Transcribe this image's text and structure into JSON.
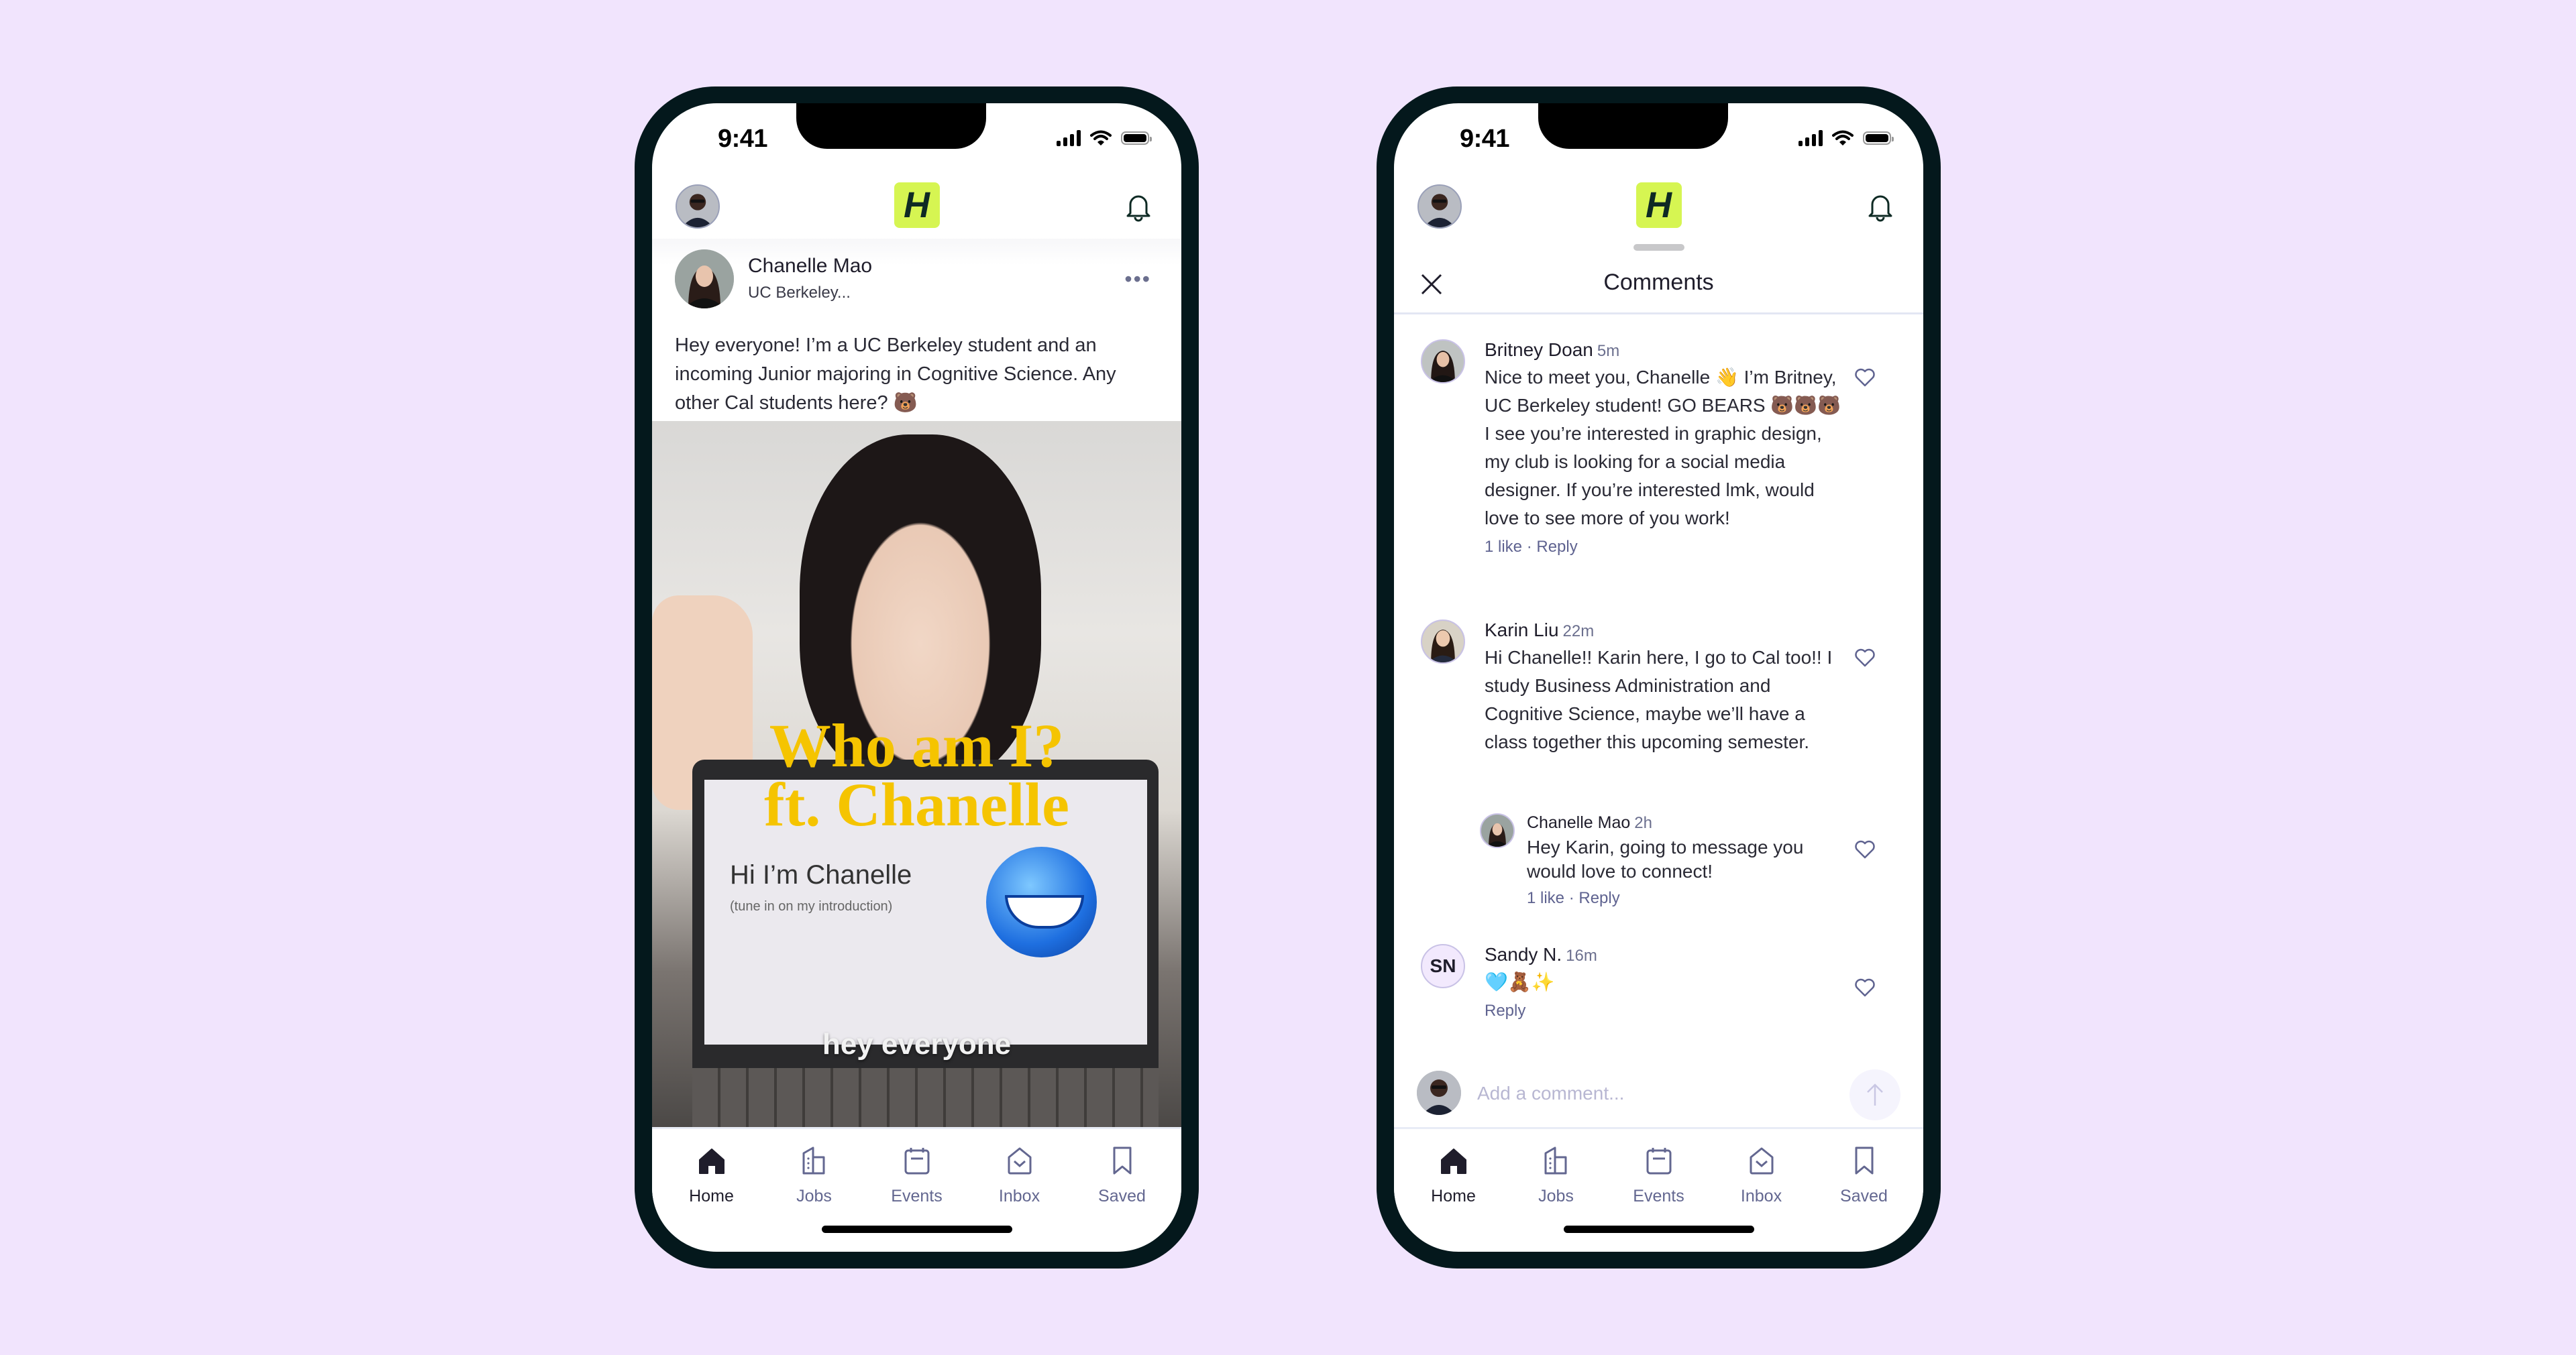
{
  "status_bar": {
    "time": "9:41"
  },
  "app": {
    "logo_letter": "H",
    "brand_color": "#d6f552",
    "background_color": "#f1e4fd"
  },
  "feed": {
    "post": {
      "author": "Chanelle Mao",
      "subtitle": "UC Berkeley...",
      "more_label": "•••",
      "text": "Hey everyone! I’m a UC Berkeley student and an incoming Junior majoring in Cognitive Science. Any other Cal students here? 🐻",
      "video": {
        "title_line1": "Who am I?",
        "title_line2": "ft. Chanelle",
        "slide_heading": "Hi I’m Chanelle",
        "slide_subtext": "(tune in on my introduction)",
        "caption": "hey everyone"
      }
    }
  },
  "comments_sheet": {
    "title": "Comments",
    "comments": [
      {
        "author": "Britney Doan",
        "time": "5m",
        "text": "Nice to meet you, Chanelle 👋 I’m Britney, UC Berkeley student! GO BEARS 🐻🐻🐻 I see you’re interested in graphic design, my club is looking for a social media designer. If you’re interested lmk, would love to see more of you work!",
        "likes": "1 like",
        "reply": "Reply"
      },
      {
        "author": "Karin Liu",
        "time": "22m",
        "text": "Hi Chanelle!! Karin here, I go to Cal too!! I study Business Administration and Cognitive Science, maybe we’ll have a class together this upcoming semester."
      },
      {
        "author": "Chanelle Mao",
        "time": "2h",
        "text": "Hey Karin, going to message you would love to connect!",
        "likes": "1 like",
        "reply": "Reply"
      },
      {
        "author": "Sandy N.",
        "initials": "SN",
        "time": "16m",
        "text": "🩵🧸✨",
        "reply": "Reply"
      }
    ],
    "input_placeholder": "Add a comment..."
  },
  "tabs": [
    {
      "label": "Home",
      "icon": "home-icon",
      "active": true
    },
    {
      "label": "Jobs",
      "icon": "building-icon"
    },
    {
      "label": "Events",
      "icon": "calendar-icon"
    },
    {
      "label": "Inbox",
      "icon": "inbox-icon"
    },
    {
      "label": "Saved",
      "icon": "bookmark-icon"
    }
  ]
}
